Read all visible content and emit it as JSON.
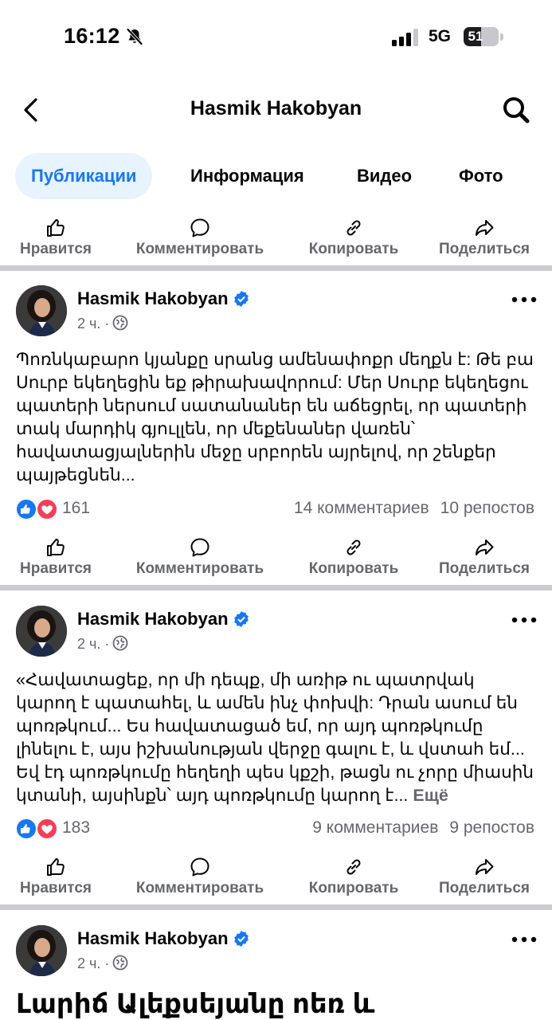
{
  "status": {
    "time": "16:12",
    "network": "5G",
    "battery": "51",
    "battery_level": 0.51
  },
  "header": {
    "title": "Hasmik Hakobyan"
  },
  "tabs": [
    {
      "label": "Публикации",
      "active": true
    },
    {
      "label": "Информация",
      "active": false
    },
    {
      "label": "Видео",
      "active": false
    },
    {
      "label": "Фото",
      "active": false
    }
  ],
  "actions": {
    "like": "Нравится",
    "comment": "Комментировать",
    "copy": "Копировать",
    "share": "Поделиться"
  },
  "posts": [
    {
      "author": "Hasmik Hakobyan",
      "time": "2 ч. ·",
      "text": "Պոռնկաբարո կյանքը սրանց ամենափոքր մեղքն է: Թե բա Սուրբ եկեղեցին եք թիրախավորում: Մեր Սուրբ եկեղեցու պատերի ներսում սատանաներ են աճեցրել, որ պատերի տակ մարդիկ գյուլլեն, որ մեքենաներ վառեն՝ հավատացյալներին մեջը սրբորեն այրելով, որ շենքեր պայթեցնեն...",
      "more": "",
      "reactions": "161",
      "comments": "14 комментариев",
      "reposts": "10 репостов"
    },
    {
      "author": "Hasmik Hakobyan",
      "time": "2 ч. ·",
      "text": "«Հավատացեք, որ մի դեպք, մի առիթ ու պատրվակ կարող է պատահել, և ամեն ինչ փոխվի: Դրան ասում են պոռթկում... Ես հավատացած եմ, որ այդ պոռթկումը լինելու է, այս իշխանության վերջը գալու է, և վստահ եմ... Եվ էդ պոռթկումը հեղեղի պես կքշի, թացն ու չորը միասին կտանի, այսինքն՝ այդ պոռթկումը կարող է...",
      "more": "Ещё",
      "reactions": "183",
      "comments": "9 комментариев",
      "reposts": "9 репостов"
    },
    {
      "author": "Hasmik Hakobyan",
      "time": "2 ч. ·",
      "title_partial": "Լարիճ Ալեքսեյանը ոեռ և"
    }
  ],
  "colors": {
    "accent": "#1877f2",
    "secondary_text": "#65676b",
    "separator": "#c9ccd1",
    "love": "#f33e58"
  }
}
